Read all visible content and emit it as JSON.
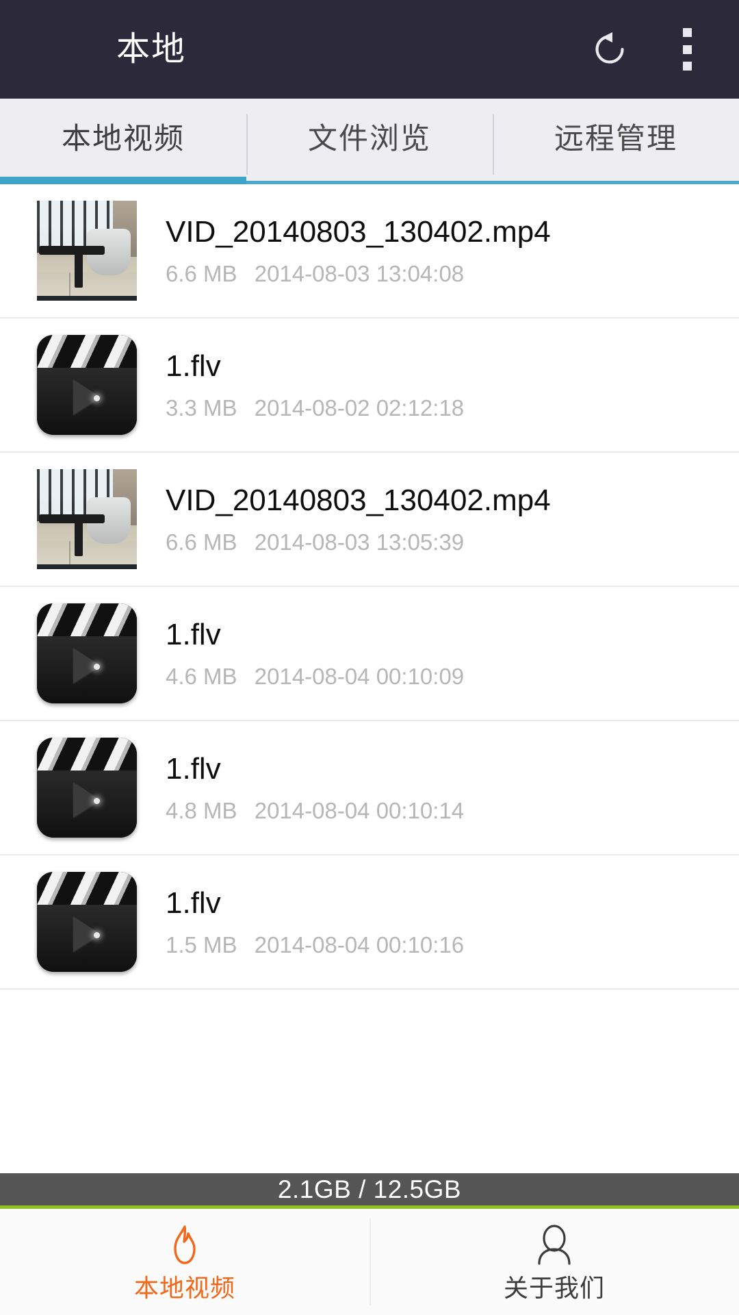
{
  "header": {
    "title": "本地",
    "refresh_icon": "refresh-icon",
    "overflow_icon": "overflow-menu-icon"
  },
  "tabs": [
    {
      "label": "本地视频",
      "active": true
    },
    {
      "label": "文件浏览",
      "active": false
    },
    {
      "label": "远程管理",
      "active": false
    }
  ],
  "colors": {
    "header_bg": "#2c2a3a",
    "tab_bg": "#eeedf2",
    "tab_indicator": "#3ba4c8",
    "storage_bg": "#565656",
    "storage_rule": "#8dc21f",
    "active_nav": "#f2681a"
  },
  "list": [
    {
      "name": "VID_20140803_130402.mp4",
      "size": "6.6 MB",
      "date": "2014-08-03 13:04:08",
      "thumb": "video-frame-thumbnail"
    },
    {
      "name": "1.flv",
      "size": "3.3 MB",
      "date": "2014-08-02 02:12:18",
      "thumb": "clapperboard-icon"
    },
    {
      "name": "VID_20140803_130402.mp4",
      "size": "6.6 MB",
      "date": "2014-08-03 13:05:39",
      "thumb": "video-frame-thumbnail"
    },
    {
      "name": "1.flv",
      "size": "4.6 MB",
      "date": "2014-08-04 00:10:09",
      "thumb": "clapperboard-icon"
    },
    {
      "name": "1.flv",
      "size": "4.8 MB",
      "date": "2014-08-04 00:10:14",
      "thumb": "clapperboard-icon"
    },
    {
      "name": "1.flv",
      "size": "1.5 MB",
      "date": "2014-08-04 00:10:16",
      "thumb": "clapperboard-icon"
    }
  ],
  "storage": {
    "used": "2.1GB",
    "total": "12.5GB",
    "text": "2.1GB / 12.5GB"
  },
  "bottom_nav": [
    {
      "label": "本地视频",
      "icon": "flame-icon",
      "active": true
    },
    {
      "label": "关于我们",
      "icon": "person-icon",
      "active": false
    }
  ]
}
